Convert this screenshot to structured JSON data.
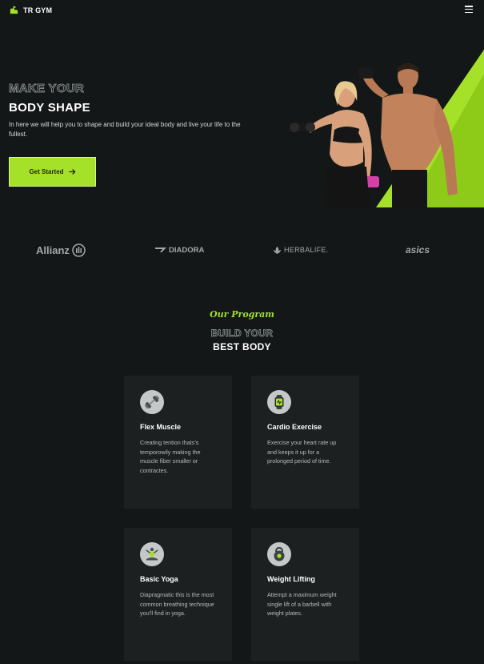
{
  "header": {
    "brand": "TR GYM",
    "logo_icon": "flexed-arm-icon",
    "menu_icon": "hamburger-menu-icon"
  },
  "hero": {
    "title_outline": "MAKE YOUR",
    "title": "BODY SHAPE",
    "description": "In here we will help you to shape and build your ideal body and live your life to the fullest.",
    "cta_label": "Get Started",
    "cta_icon": "arrow-right-icon",
    "image": "fitness-couple-photo"
  },
  "brands": [
    {
      "name": "Allianz"
    },
    {
      "name": "DIADORA"
    },
    {
      "name": "HERBALIFE."
    },
    {
      "name": "asics"
    }
  ],
  "program": {
    "kicker": "Our Program",
    "title_outline": "BUILD YOUR",
    "title": "BEST BODY",
    "cards": [
      {
        "title": "Flex Muscle",
        "desc": "Creating tention thats's temporowily making the muscle fiber smaller or contractes.",
        "icon": "dumbbell-icon"
      },
      {
        "title": "Cardio Exercise",
        "desc": "Exercise your heart rate up and keeps it up for a prolonged period of time.",
        "icon": "fitness-tracker-icon"
      },
      {
        "title": "Basic Yoga",
        "desc": "Diapragmatic this is the most common breathing technique you'll find in yoga.",
        "icon": "yoga-pose-icon"
      },
      {
        "title": "Weight Lifting",
        "desc": "Attempt a maximum weight single lift of a barbell with weight plates.",
        "icon": "kettlebell-icon"
      }
    ]
  },
  "colors": {
    "accent": "#a6e12a",
    "background": "#131717",
    "card": "#1c2020"
  }
}
